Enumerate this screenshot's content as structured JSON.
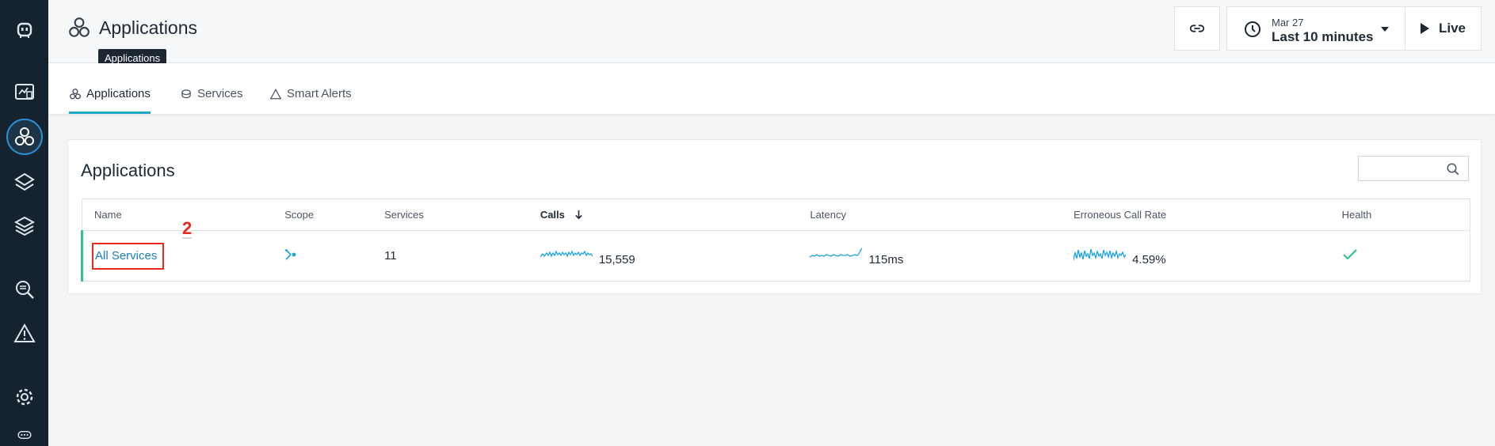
{
  "sidebar": {
    "items": [
      {
        "icon": "robot-logo-icon"
      },
      {
        "icon": "monitor-dashboard-icon"
      },
      {
        "icon": "applications-icon",
        "active": true
      },
      {
        "icon": "platform-layers-icon"
      },
      {
        "icon": "stack-icon"
      },
      {
        "icon": "analytics-search-icon"
      },
      {
        "icon": "alert-triangle-icon"
      },
      {
        "icon": "settings-gear-icon"
      },
      {
        "icon": "more-icon"
      }
    ]
  },
  "header": {
    "title": "Applications",
    "tooltip": "Applications",
    "time": {
      "date": "Mar 27",
      "range": "Last 10 minutes"
    },
    "live_label": "Live"
  },
  "tabs": [
    {
      "label": "Applications",
      "active": true
    },
    {
      "label": "Services",
      "active": false
    },
    {
      "label": "Smart Alerts",
      "active": false
    }
  ],
  "card": {
    "title": "Applications",
    "search_placeholder": ""
  },
  "table": {
    "columns": [
      "Name",
      "Scope",
      "Services",
      "Calls",
      "Latency",
      "Erroneous Call Rate",
      "Health"
    ],
    "sorted_column": "Calls",
    "rows": [
      {
        "name": "All Services",
        "services": "11",
        "calls": "15,559",
        "latency": "115ms",
        "error_rate": "4.59%",
        "health": "ok"
      }
    ]
  },
  "annotation": {
    "label": "2"
  },
  "colors": {
    "accent": "#1ea7c5",
    "link": "#1a7fbf",
    "spark": "#1aa3e0",
    "health_ok": "#34c38f",
    "highlight": "#e8291e"
  }
}
